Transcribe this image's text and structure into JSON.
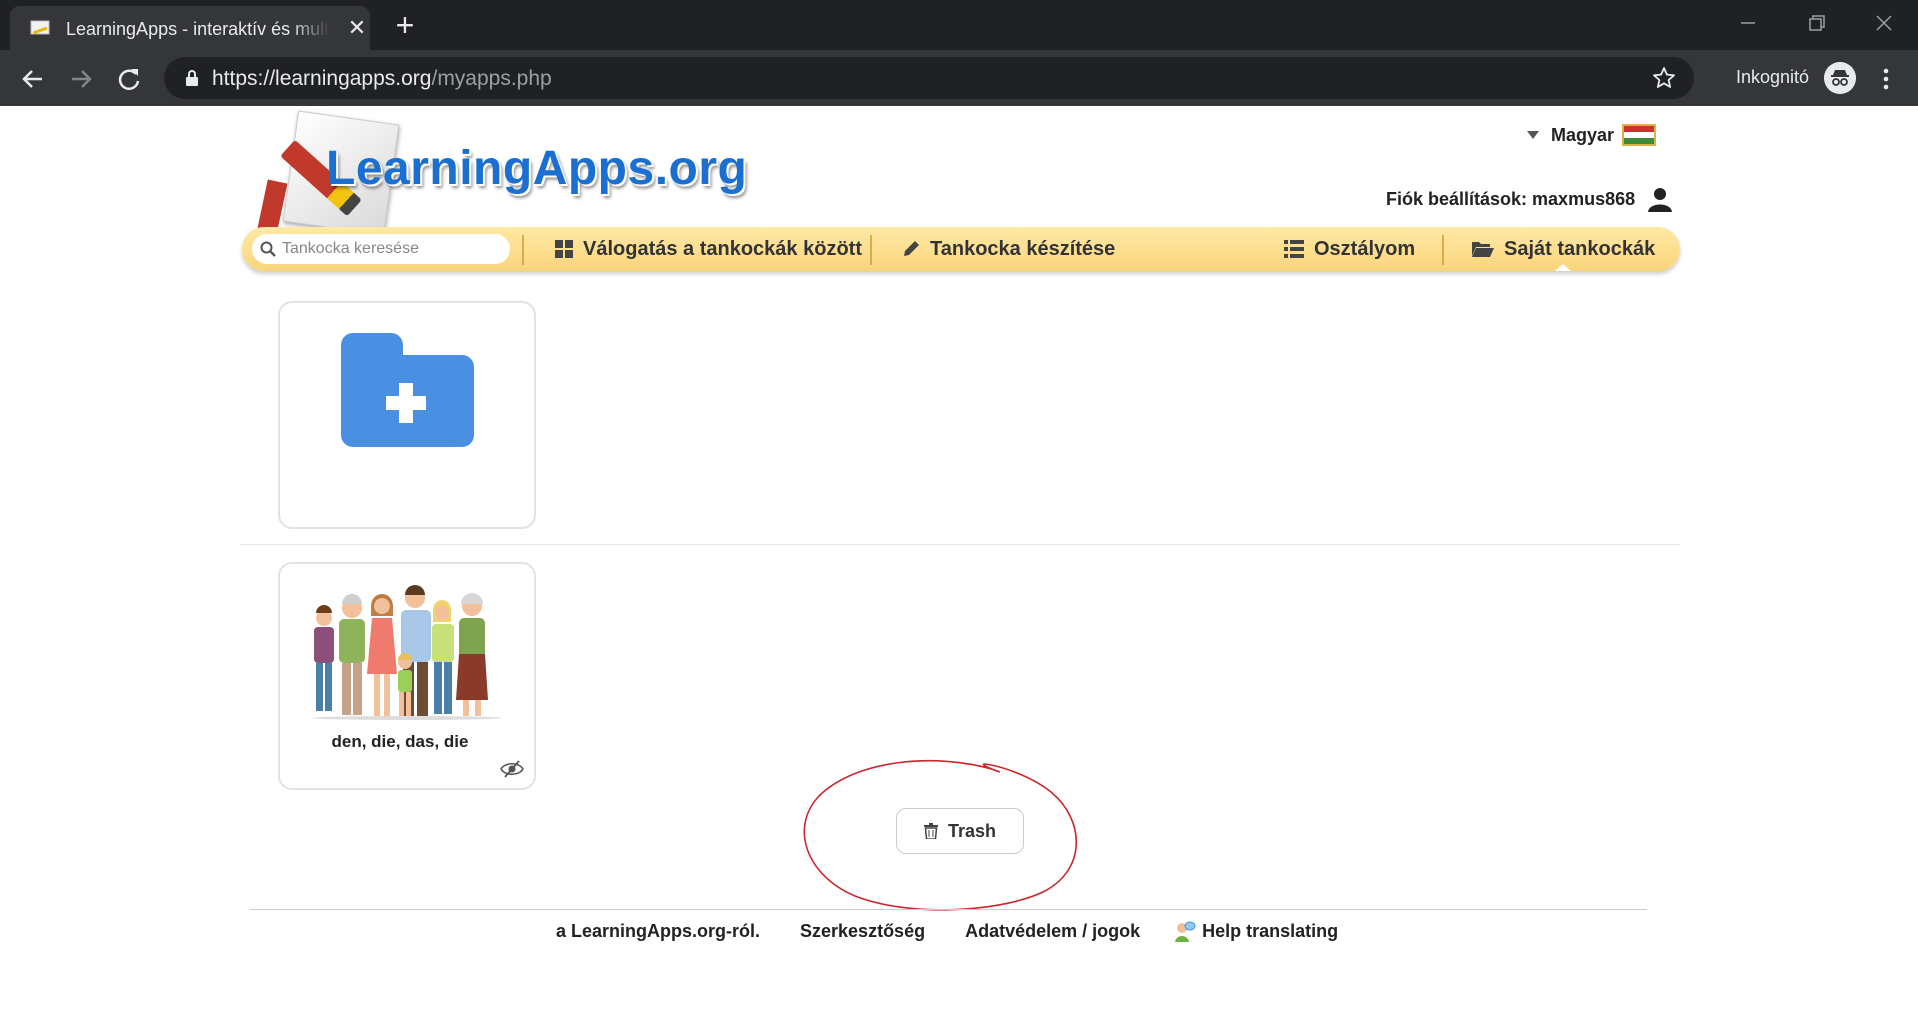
{
  "browser": {
    "tab_title": "LearningApps - interaktív és multimédiás tanulási modulok",
    "url_host": "https://learningapps.org",
    "url_path": "/myapps.php",
    "incognito_label": "Inkognitó"
  },
  "header": {
    "logo_text": "LearningApps.org",
    "language": "Magyar",
    "account_label": "Fiók beállítások: maxmus868"
  },
  "navbar": {
    "search_placeholder": "Tankocka keresése",
    "items": [
      {
        "label": "Válogatás a tankockák között",
        "icon": "grid-icon"
      },
      {
        "label": "Tankocka készítése",
        "icon": "pencil-icon"
      },
      {
        "label": "Osztályom",
        "icon": "list-icon"
      },
      {
        "label": "Saját tankockák",
        "icon": "folder-open-icon"
      }
    ]
  },
  "apps": [
    {
      "title": "den, die, das, die",
      "icon": "hidden-eye-icon"
    }
  ],
  "trash_label": "Trash",
  "footer": {
    "links": [
      "a LearningApps.org-ról.",
      "Szerkesztőség",
      "Adatvédelem / jogok",
      "Help translating"
    ]
  },
  "colors": {
    "navbar": "#f9d57b",
    "folder": "#4a90e2",
    "logo": "#1a6fd1",
    "annotation": "#c8282d"
  }
}
